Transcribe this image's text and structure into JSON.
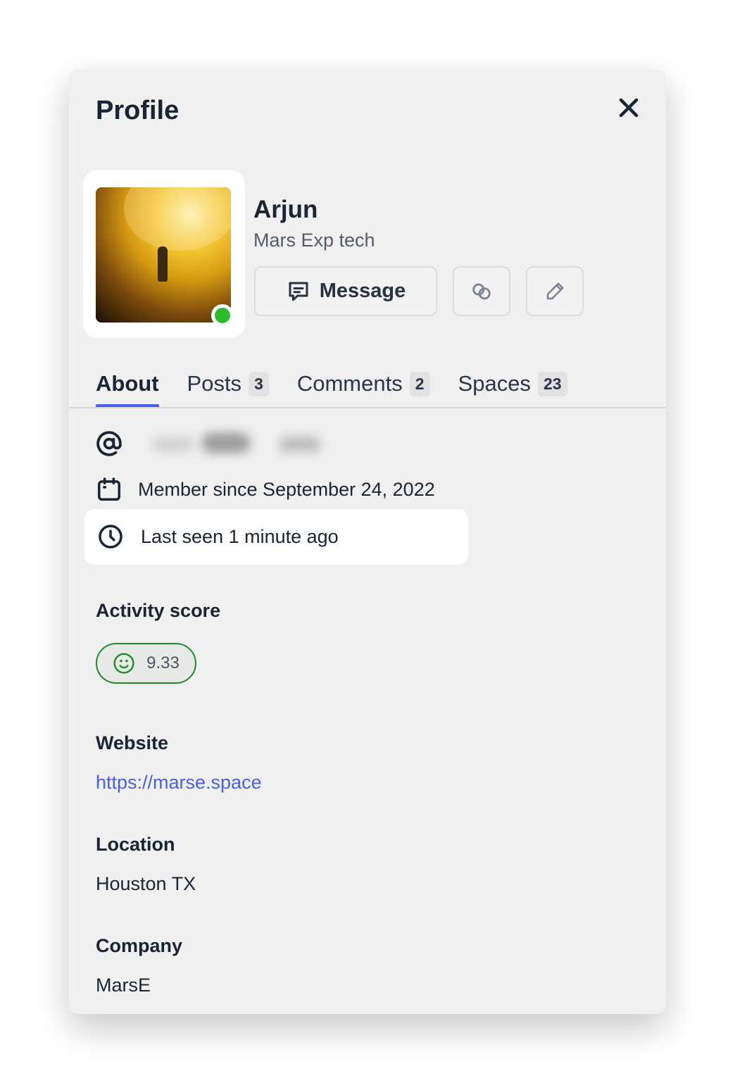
{
  "header": {
    "title": "Profile",
    "close_icon": "close-icon"
  },
  "profile": {
    "name": "Arjun",
    "subtitle": "Mars Exp tech",
    "online": true,
    "status_color": "#2dbb2d"
  },
  "actions": {
    "message_label": "Message",
    "message_icon": "chat-icon",
    "link_icon": "link-icon",
    "edit_icon": "pencil-icon"
  },
  "tabs": [
    {
      "label": "About",
      "active": true
    },
    {
      "label": "Posts",
      "count": "3"
    },
    {
      "label": "Comments",
      "count": "2"
    },
    {
      "label": "Spaces",
      "count": "23"
    }
  ],
  "about": {
    "member_since": "Member since September 24, 2022",
    "last_seen": "Last seen 1 minute ago"
  },
  "activity": {
    "label": "Activity score",
    "score": "9.33",
    "color": "#1f8a2c"
  },
  "website": {
    "label": "Website",
    "url": "https://marse.space"
  },
  "location": {
    "label": "Location",
    "value": "Houston TX"
  },
  "company": {
    "label": "Company",
    "value": "MarsE"
  },
  "accent": "#4a5ee8"
}
